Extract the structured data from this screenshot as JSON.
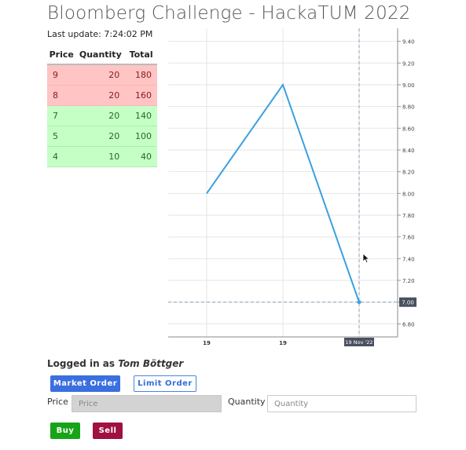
{
  "header": {
    "title": "Bloomberg Challenge - HackaTUM 2022",
    "last_update": "Last update: 7:24:02 PM"
  },
  "order_book": {
    "columns": [
      "Price",
      "Quantity",
      "Total"
    ],
    "asks": [
      {
        "price": "9",
        "quantity": "20",
        "total": "180"
      },
      {
        "price": "8",
        "quantity": "20",
        "total": "160"
      }
    ],
    "bids": [
      {
        "price": "7",
        "quantity": "20",
        "total": "140"
      },
      {
        "price": "5",
        "quantity": "20",
        "total": "100"
      },
      {
        "price": "4",
        "quantity": "10",
        "total": "40"
      }
    ],
    "colors": {
      "ask_bg": "#ffc4c4",
      "bid_bg": "#c6ffc6"
    }
  },
  "chart_data": {
    "type": "line",
    "title": "",
    "xlabel": "",
    "ylabel": "",
    "x_tick_labels": [
      "19",
      "19"
    ],
    "crosshair_x_label": "19 Nov '22",
    "crosshair_y_label": "7.00",
    "y_ticks": [
      "6.80",
      "7.00",
      "7.20",
      "7.40",
      "7.60",
      "7.80",
      "8.00",
      "8.20",
      "8.40",
      "8.60",
      "8.80",
      "9.00",
      "9.20",
      "9.40"
    ],
    "ylim": [
      6.68,
      9.52
    ],
    "grid": true,
    "series": [
      {
        "color": "#3aa0e0",
        "points": [
          {
            "x": 0,
            "y": 8.0
          },
          {
            "x": 1,
            "y": 9.0
          },
          {
            "x": 2,
            "y": 7.0
          }
        ]
      }
    ]
  },
  "user": {
    "logged_in_prefix": "Logged in as",
    "name": "Tom Böttger"
  },
  "order_form": {
    "market_order_label": "Market Order",
    "limit_order_label": "Limit Order",
    "price_label": "Price",
    "price_placeholder": "Price",
    "quantity_label": "Quantity",
    "quantity_placeholder": "Quantity",
    "buy_label": "Buy",
    "sell_label": "Sell"
  }
}
